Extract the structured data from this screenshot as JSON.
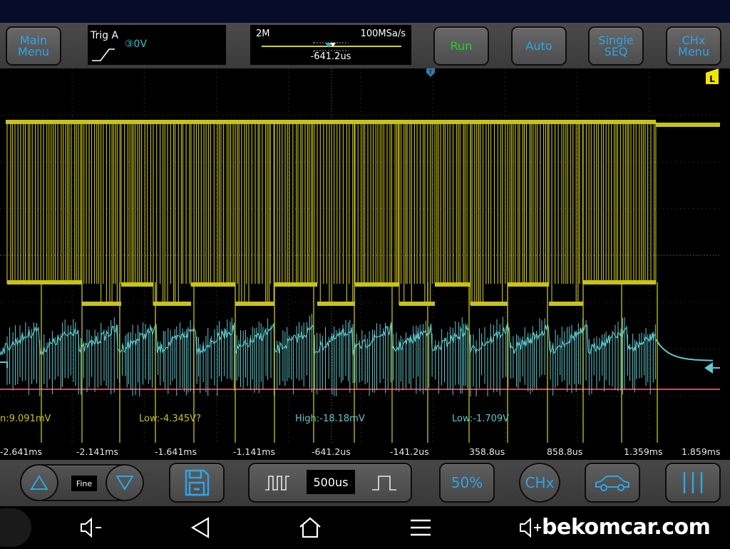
{
  "toolbar": {
    "main_menu": "Main\nMenu",
    "run": "Run",
    "auto": "Auto",
    "single": "Single\nSEQ",
    "chx_menu": "CHx\nMenu"
  },
  "trigger": {
    "label": "Trig A",
    "channel_level": "③0V"
  },
  "timebase": {
    "scale": "2M",
    "sample_rate": "100MSa/s",
    "offset": "-641.2us"
  },
  "markers": {
    "trigger_pos": "T",
    "trigger_level": "L"
  },
  "measurements": [
    {
      "text": "n:9.091mV"
    },
    {
      "text": "Low:-4.345V?"
    },
    {
      "text": "High:-18.18mV"
    },
    {
      "text": "Low:-1.709V"
    }
  ],
  "time_axis": [
    "-2.641ms",
    "-2.141ms",
    "-1.641ms",
    "-1.141ms",
    "-641.2us",
    "-141.2us",
    "358.8us",
    "858.8us",
    "1.359ms",
    "1.859ms"
  ],
  "bottom": {
    "fine": "Fine",
    "timebase": "500us",
    "fifty": "50%",
    "chx": "CHx"
  },
  "nav": {
    "watermark": "bekomcar.com"
  },
  "colors": {
    "ch1": "#c8c319",
    "ch2": "#5ec8cc",
    "ref": "#ff6b7d",
    "accent": "#2fa4e7",
    "run": "#1ed22a"
  },
  "icons": [
    "up-triangle-icon",
    "down-triangle-icon",
    "save-icon",
    "pulse-narrow-icon",
    "pulse-wide-icon",
    "car-icon",
    "bars-icon",
    "volume-down-icon",
    "back-icon",
    "home-icon",
    "menu-icon",
    "volume-up-icon"
  ]
}
